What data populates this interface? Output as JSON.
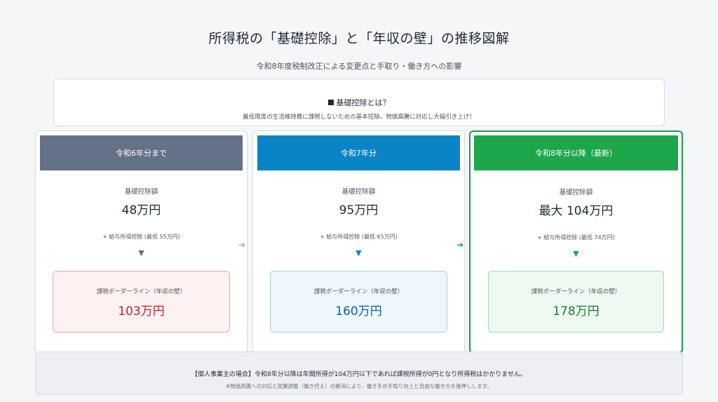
{
  "header": {
    "title": "所得税の「基礎控除」と「年収の壁」の推移図解",
    "subtitle": "令和8年度税制改正による変更点と手取り・働き方への影響"
  },
  "intro": {
    "heading": "基礎控除とは？",
    "text": "最低限度の生活維持費に課税しないための基本控除。物価高騰に対応し大幅引き上げ！"
  },
  "colors": {
    "period1": "#647287",
    "period2": "#0b84c6",
    "period3": "#1ea64a"
  },
  "periods": [
    {
      "header": "令和6年分まで",
      "deduction_label": "基礎控除額",
      "deduction_value": "48万円",
      "salary_note": "+ 給与所得控除 (最低 55万円)",
      "wall_label": "課税ボーダーライン（年収の壁）",
      "wall_value": "103万円"
    },
    {
      "header": "令和7年分",
      "deduction_label": "基礎控除額",
      "deduction_value": "95万円",
      "salary_note": "+ 給与所得控除 (最低 65万円)",
      "wall_label": "課税ボーダーライン（年収の壁）",
      "wall_value": "160万円"
    },
    {
      "header": "令和8年分以降（最新）",
      "deduction_label": "基礎控除額",
      "deduction_value": "最大 104万円",
      "salary_note": "+ 給与所得控除 (最低 74万円)",
      "wall_label": "課税ボーダーライン（年収の壁）",
      "wall_value": "178万円"
    }
  ],
  "footer": {
    "main": "【個人事業主の場合】令和8年分以降は年間所得が104万円以下であれば課税所得が0円となり所得税はかかりません。",
    "note": "※物価高騰への対応と就業調整（働き控え）の解消により、働き手の手取り向上と自由な働き方を後押しします。"
  }
}
